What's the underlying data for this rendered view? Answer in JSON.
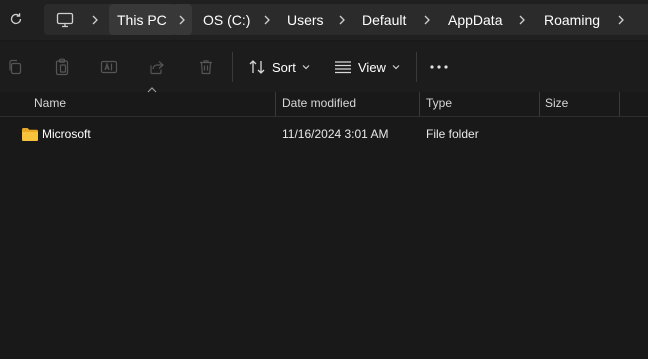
{
  "breadcrumb": {
    "items": [
      "This PC",
      "OS (C:)",
      "Users",
      "Default",
      "AppData",
      "Roaming"
    ]
  },
  "toolbar": {
    "sort_label": "Sort",
    "view_label": "View"
  },
  "columns": {
    "name": "Name",
    "date_modified": "Date modified",
    "type": "Type",
    "size": "Size"
  },
  "files": [
    {
      "name": "Microsoft",
      "date_modified": "11/16/2024 3:01 AM",
      "type": "File folder",
      "size": ""
    }
  ],
  "colors": {
    "background": "#191919",
    "address_bar": "#2b2b2b",
    "folder_icon": "#f7c33d"
  }
}
